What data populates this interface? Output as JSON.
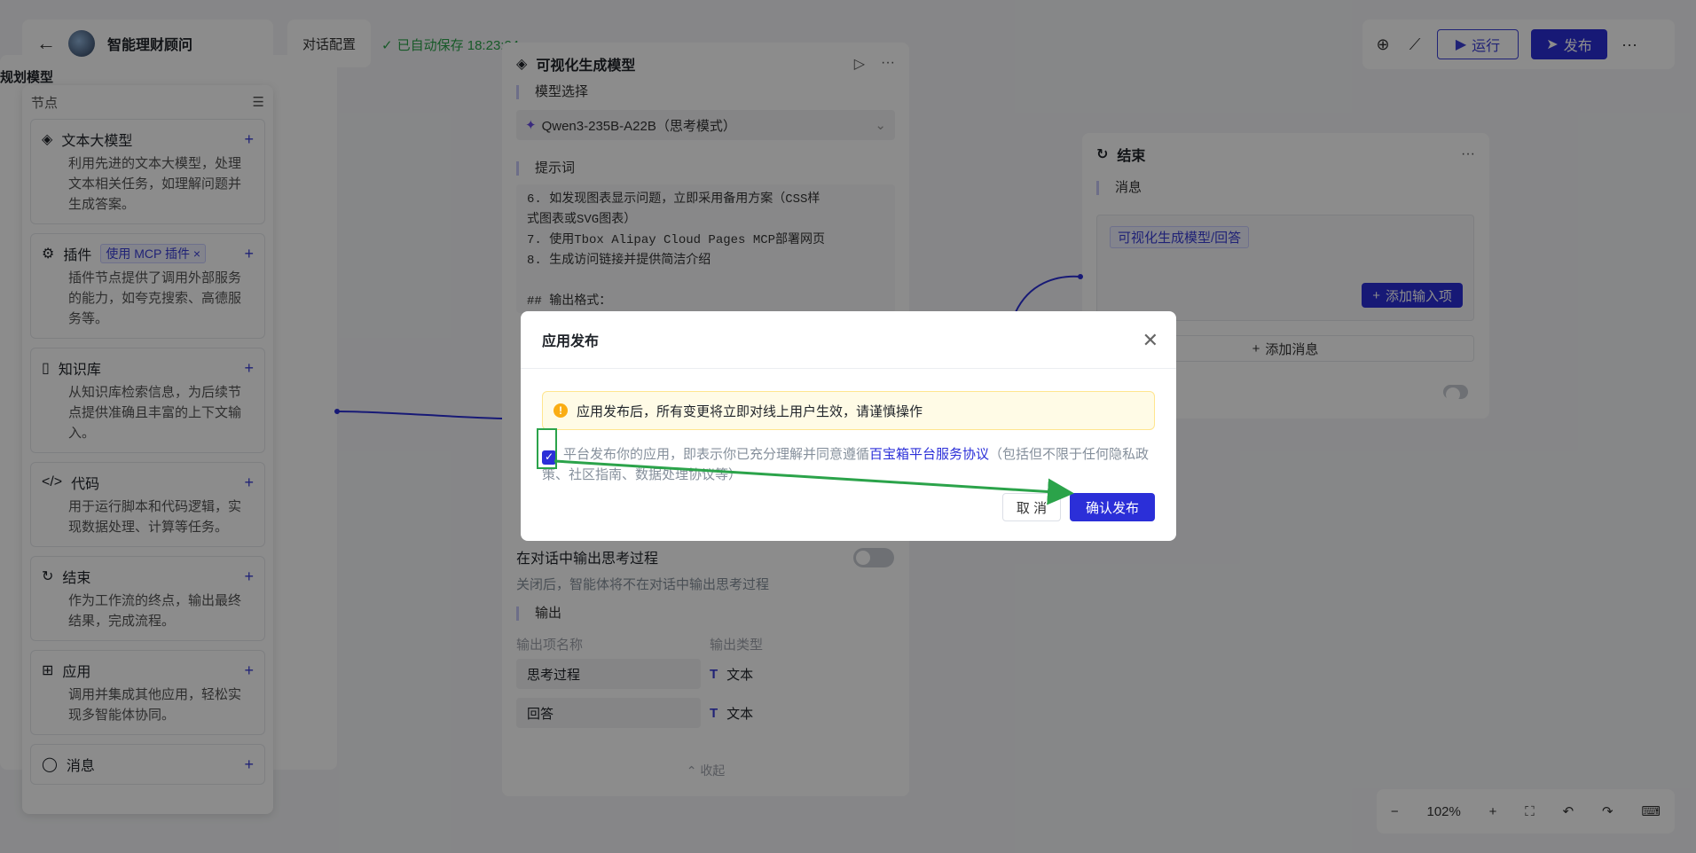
{
  "app": {
    "title": "智能理财顾问",
    "back_icon": "arrow-left-icon",
    "config_label": "对话配置",
    "autosave": "已自动保存 18:23:24"
  },
  "toolbar": {
    "run_label": "运行",
    "publish_label": "发布",
    "icons": [
      "globe-icon",
      "chart-line-icon",
      "more-icon"
    ]
  },
  "left_panel": {
    "title": "规划模型"
  },
  "node_library": {
    "title": "节点",
    "items": [
      {
        "name": "文本大模型",
        "desc": "利用先进的文本大模型，处理文本相关任务，如理解问题并生成答案。"
      },
      {
        "name": "插件",
        "tag": "使用 MCP 插件",
        "desc": "插件节点提供了调用外部服务的能力，如夸克搜索、高德服务等。"
      },
      {
        "name": "知识库",
        "desc": "从知识库检索信息，为后续节点提供准确且丰富的上下文输入。"
      },
      {
        "name": "代码",
        "desc": "用于运行脚本和代码逻辑，实现数据处理、计算等任务。"
      },
      {
        "name": "结束",
        "desc": "作为工作流的终点，输出最终结果，完成流程。"
      },
      {
        "name": "应用",
        "desc": "调用并集成其他应用，轻松实现多智能体协同。"
      },
      {
        "name": "消息",
        "desc": ""
      }
    ]
  },
  "middle_panel": {
    "title": "可视化生成模型",
    "model_label": "模型选择",
    "model_value": "Qwen3-235B-A22B（思考模式）",
    "prompt_label": "提示词",
    "prompt_lines": [
      "6. 如发现图表显示问题，立即采用备用方案（CSS样",
      "式图表或SVG图表）",
      "7. 使用Tbox Alipay Cloud Pages MCP部署网页",
      "8. 生成访问链接并提供简洁介绍",
      "",
      "## 输出格式："
    ],
    "think_title": "在对话中输出思考过程",
    "think_desc": "关闭后，智能体将不在对话中输出思考过程",
    "output_label": "输出",
    "output_col_name": "输出项名称",
    "output_col_type": "输出类型",
    "outputs": [
      {
        "name": "思考过程",
        "type": "文本"
      },
      {
        "name": "回答",
        "type": "文本"
      }
    ],
    "collapse": "收起"
  },
  "end_panel": {
    "title": "结束",
    "msg_label": "消息",
    "var_tag": "可视化生成模型/回答",
    "add_input": "添加输入项",
    "add_msg": "添加消息"
  },
  "zoom": {
    "level": "102%"
  },
  "dialog": {
    "title": "应用发布",
    "warning": "应用发布后，所有变更将立即对线上用户生效，请谨慎操作",
    "agree_prefix": "平台发布你的应用，即表示你已充分理解并同意遵循",
    "agree_link": "百宝箱平台服务协议",
    "agree_suffix": "（包括但不限于任何隐私政策、社区指南、数据处理协议等）",
    "cancel": "取 消",
    "confirm": "确认发布"
  }
}
